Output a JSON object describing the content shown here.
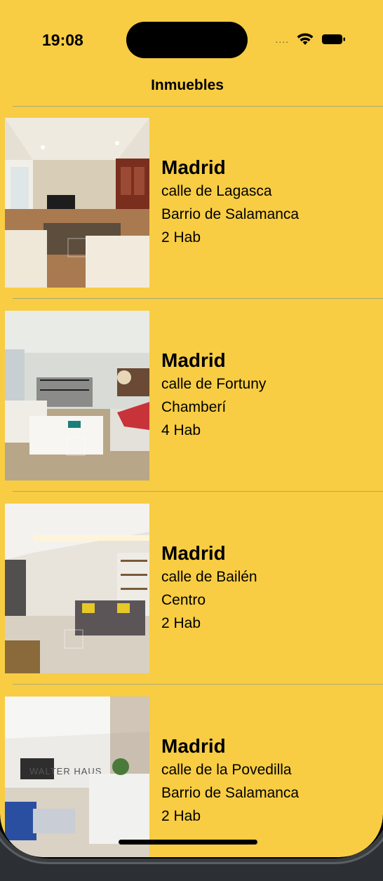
{
  "status_bar": {
    "time": "19:08",
    "signal": "....",
    "wifi_icon": "wifi-icon",
    "battery_icon": "battery-icon"
  },
  "nav": {
    "title": "Inmuebles"
  },
  "listings": [
    {
      "city": "Madrid",
      "street": "calle de Lagasca",
      "district": "Barrio de Salamanca",
      "rooms": "2 Hab"
    },
    {
      "city": "Madrid",
      "street": "calle de Fortuny",
      "district": "Chamberí",
      "rooms": "4 Hab"
    },
    {
      "city": "Madrid",
      "street": "calle de Bailén",
      "district": "Centro",
      "rooms": "2 Hab"
    },
    {
      "city": "Madrid",
      "street": "calle de la Povedilla",
      "district": "Barrio de Salamanca",
      "rooms": "2 Hab"
    }
  ],
  "photo_overlays": {
    "watermark_text": "WALTER HAUS"
  },
  "colors": {
    "background": "#f8cd43",
    "text": "#000000",
    "separator": "#8a9a8a"
  }
}
